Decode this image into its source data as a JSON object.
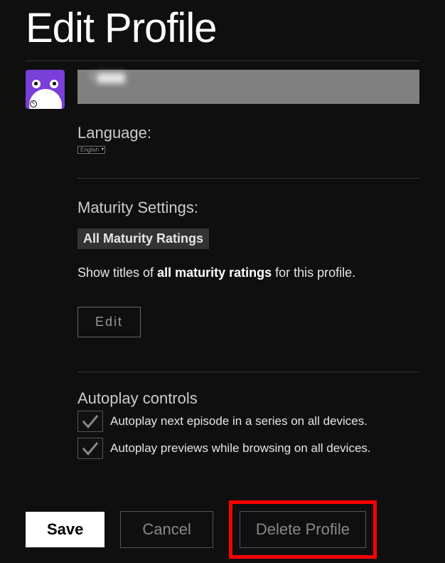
{
  "page": {
    "title": "Edit Profile"
  },
  "profile": {
    "name": "I ▆▆▆"
  },
  "language": {
    "label": "Language:",
    "selected": "English"
  },
  "maturity": {
    "label": "Maturity Settings:",
    "badge": "All Maturity Ratings",
    "desc_prefix": "Show titles of ",
    "desc_bold": "all maturity ratings",
    "desc_suffix": " for this profile.",
    "edit_label": "Edit"
  },
  "autoplay": {
    "label": "Autoplay controls",
    "opt_next": "Autoplay next episode in a series on all devices.",
    "opt_previews": "Autoplay previews while browsing on all devices."
  },
  "footer": {
    "save": "Save",
    "cancel": "Cancel",
    "delete": "Delete Profile"
  }
}
